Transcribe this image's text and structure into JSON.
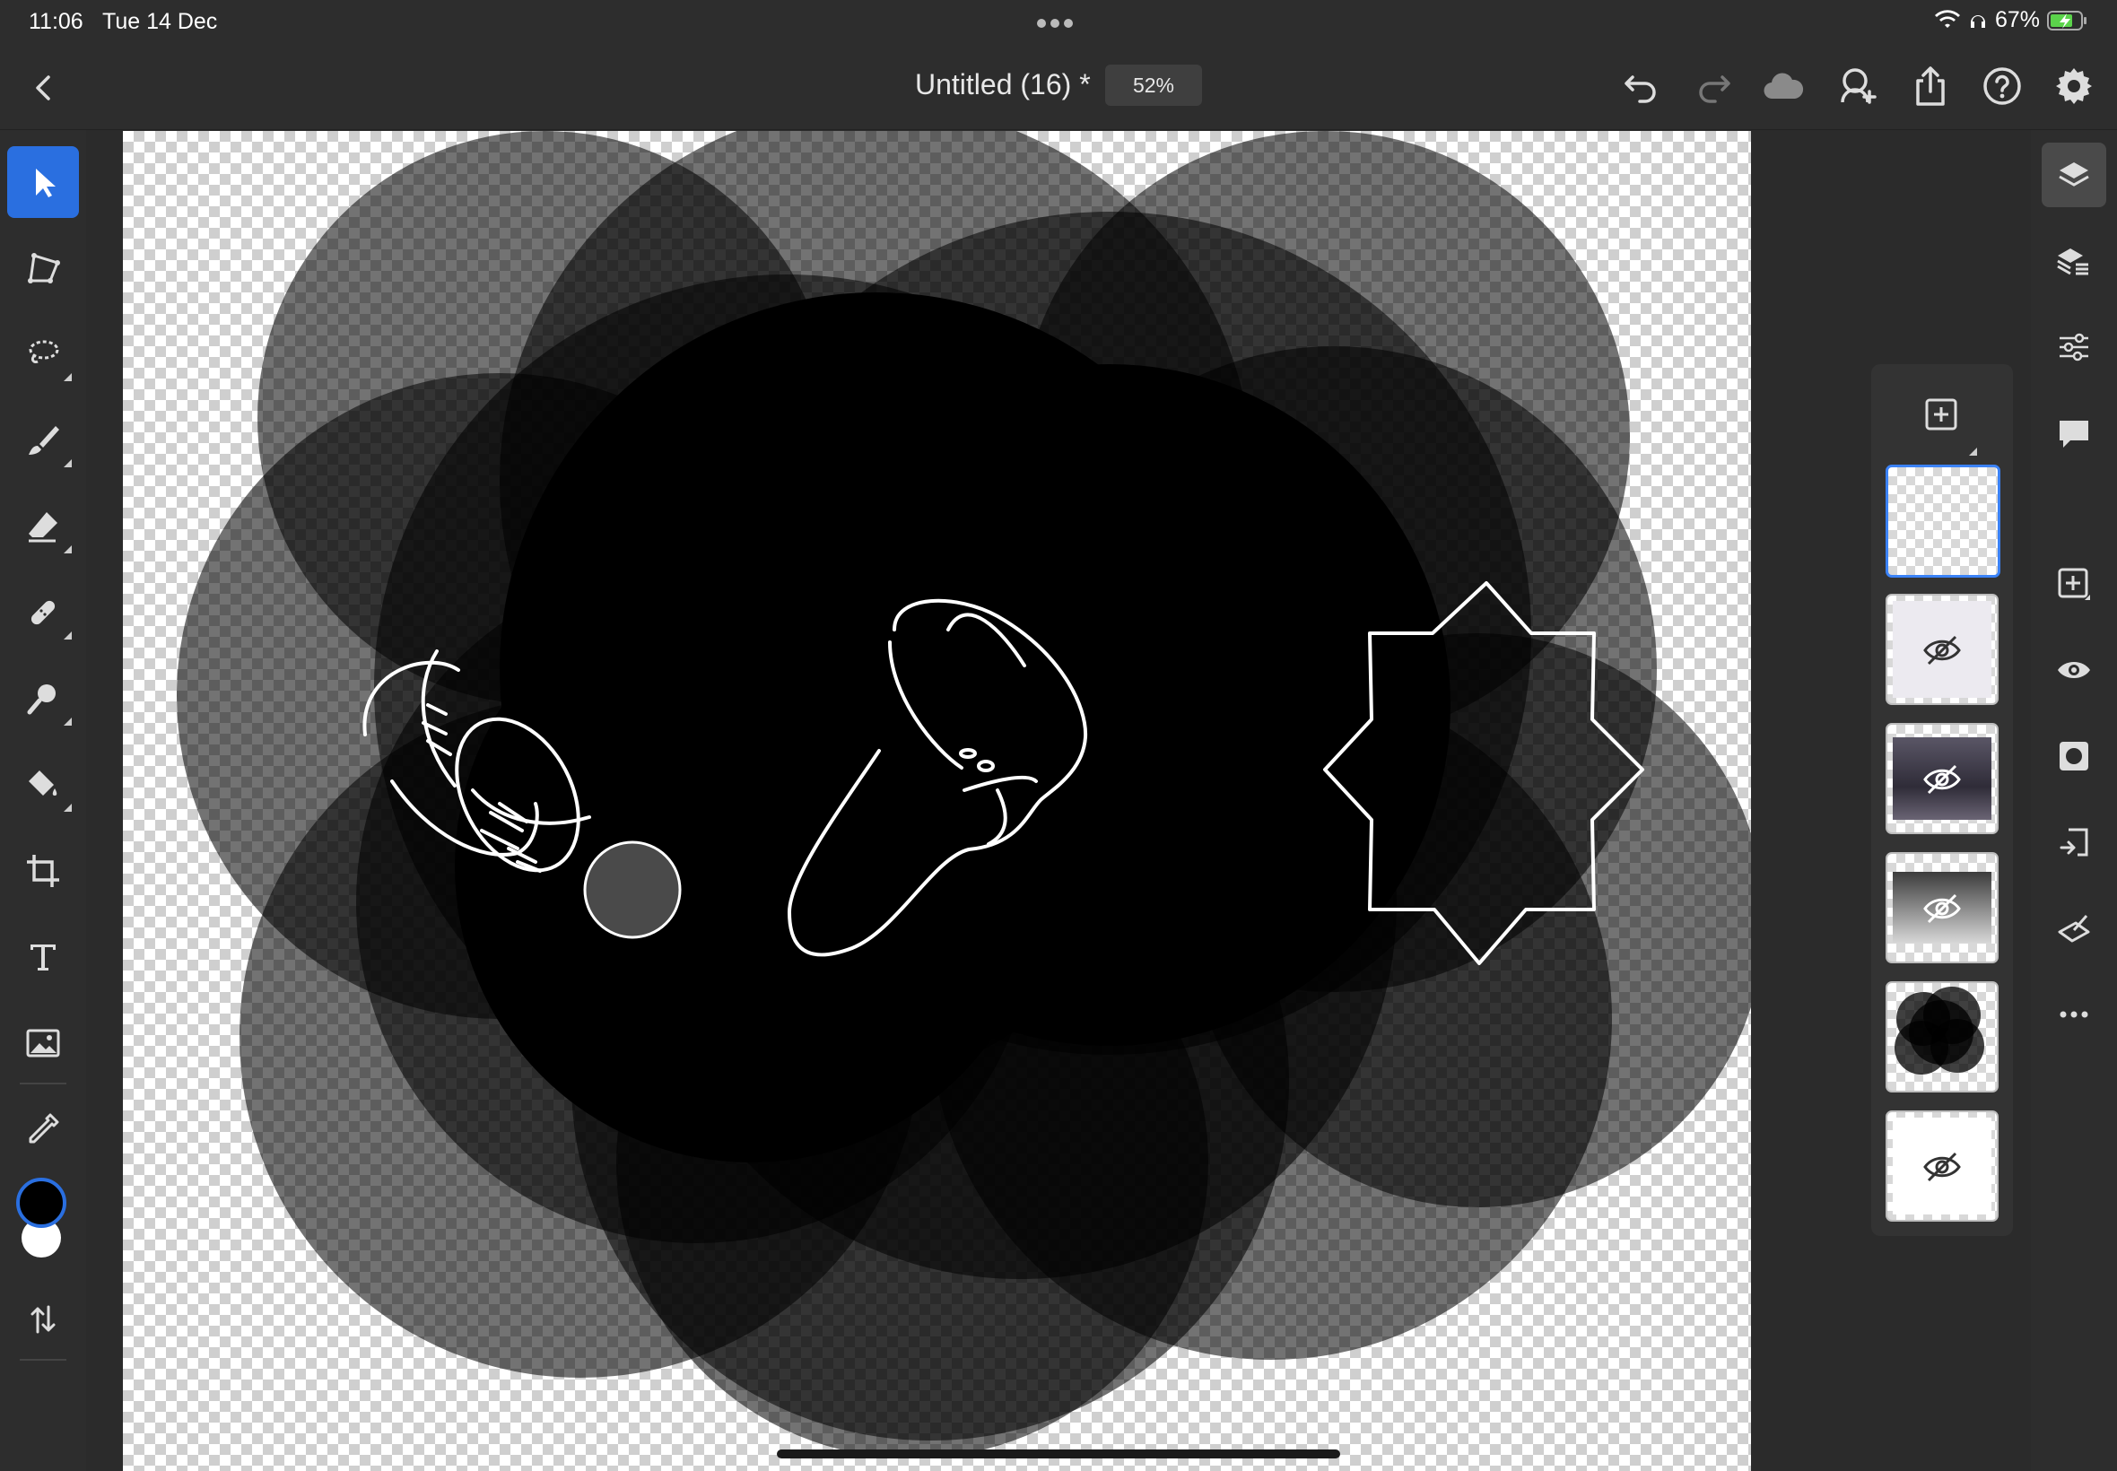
{
  "status_bar": {
    "time": "11:06",
    "date": "Tue 14 Dec",
    "battery_percent": "67%",
    "icons": [
      "wifi-icon",
      "headphones-icon",
      "battery-charging-icon"
    ]
  },
  "header": {
    "title": "Untitled (16) *",
    "zoom": "52%",
    "actions": [
      "back-icon",
      "undo-icon",
      "redo-icon",
      "cloud-icon",
      "invite-icon",
      "share-icon",
      "help-icon",
      "settings-icon"
    ]
  },
  "toolbar": {
    "tools": [
      "select",
      "transform",
      "lasso",
      "brush",
      "eraser",
      "healing",
      "smudge",
      "fill",
      "crop",
      "type",
      "image",
      "eyedropper",
      "swap-colors"
    ],
    "active_tool": "select",
    "primary_color": "#000000",
    "secondary_color": "#ffffff",
    "accent_color": "#2a6fe0"
  },
  "right_panel": {
    "icons": [
      "layers-icon",
      "layer-properties-icon",
      "adjustments-icon",
      "comments-icon",
      "add-layer-icon",
      "visibility-icon",
      "mask-icon",
      "import-icon",
      "clear-icon",
      "more-icon"
    ]
  },
  "layers_panel": {
    "layers": [
      {
        "name": "empty-layer",
        "hidden": false,
        "selected": true
      },
      {
        "name": "sketch-layer",
        "hidden": true,
        "selected": false
      },
      {
        "name": "photo-layer-1",
        "hidden": true,
        "selected": false
      },
      {
        "name": "photo-layer-2",
        "hidden": true,
        "selected": false
      },
      {
        "name": "black-blobs-layer",
        "hidden": false,
        "selected": false
      },
      {
        "name": "white-layer",
        "hidden": true,
        "selected": false
      }
    ]
  }
}
